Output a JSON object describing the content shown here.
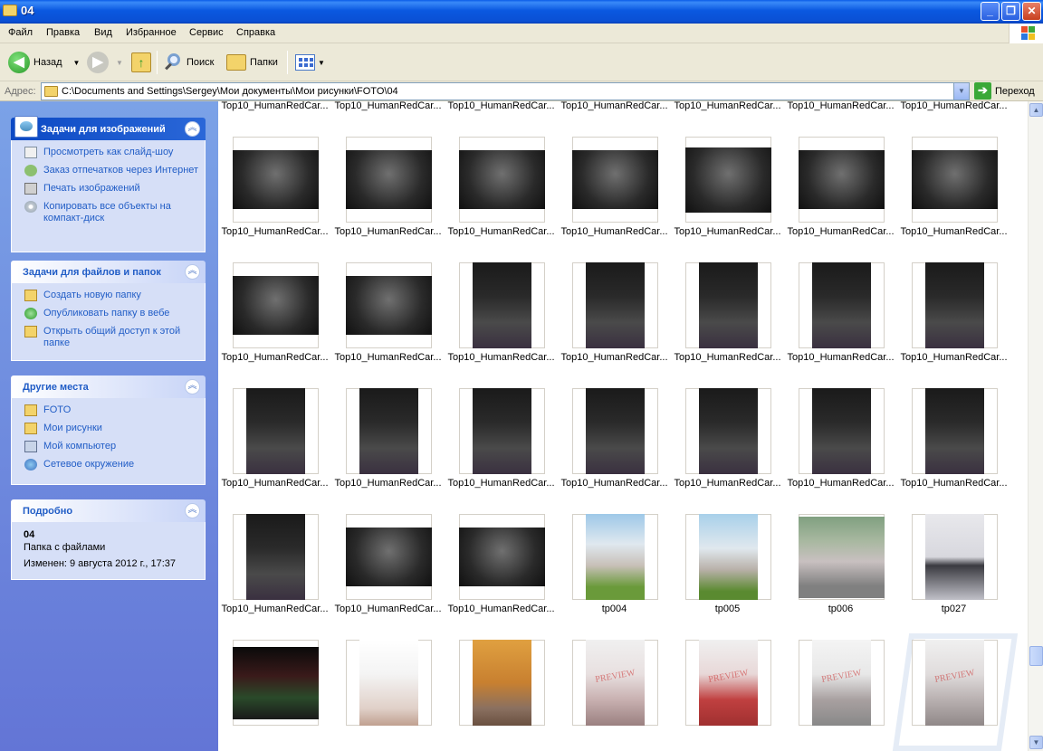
{
  "window": {
    "title": "04"
  },
  "menu": [
    "Файл",
    "Правка",
    "Вид",
    "Избранное",
    "Сервис",
    "Справка"
  ],
  "toolbar": {
    "back": "Назад",
    "search": "Поиск",
    "folders": "Папки"
  },
  "address": {
    "label": "Адрес:",
    "path": "C:\\Documents and Settings\\Sergey\\Мои документы\\Мои рисунки\\FOTO\\04",
    "go": "Переход"
  },
  "sidebar": {
    "image_tasks": {
      "title": "Задачи для изображений",
      "items": [
        "Просмотреть как слайд-шоу",
        "Заказ отпечатков через Интернет",
        "Печать изображений",
        "Копировать все объекты на компакт-диск"
      ]
    },
    "file_tasks": {
      "title": "Задачи для файлов и папок",
      "items": [
        "Создать новую папку",
        "Опубликовать папку в вебе",
        "Открыть общий доступ к этой папке"
      ]
    },
    "other_places": {
      "title": "Другие места",
      "items": [
        "FOTO",
        "Мои рисунки",
        "Мой компьютер",
        "Сетевое окружение"
      ]
    },
    "details": {
      "title": "Подробно",
      "name": "04",
      "type": "Папка с файлами",
      "modified": "Изменен: 9 августа 2012 г., 17:37"
    }
  },
  "files": {
    "row0": [
      "Top10_HumanRedCar...",
      "Top10_HumanRedCar...",
      "Top10_HumanRedCar...",
      "Top10_HumanRedCar...",
      "Top10_HumanRedCar...",
      "Top10_HumanRedCar...",
      "Top10_HumanRedCar..."
    ],
    "row1": [
      "Top10_HumanRedCar...",
      "Top10_HumanRedCar...",
      "Top10_HumanRedCar...",
      "Top10_HumanRedCar...",
      "Top10_HumanRedCar...",
      "Top10_HumanRedCar...",
      "Top10_HumanRedCar..."
    ],
    "row2": [
      "Top10_HumanRedCar...",
      "Top10_HumanRedCar...",
      "Top10_HumanRedCar...",
      "Top10_HumanRedCar...",
      "Top10_HumanRedCar...",
      "Top10_HumanRedCar...",
      "Top10_HumanRedCar..."
    ],
    "row3": [
      "Top10_HumanRedCar...",
      "Top10_HumanRedCar...",
      "Top10_HumanRedCar...",
      "Top10_HumanRedCar...",
      "Top10_HumanRedCar...",
      "Top10_HumanRedCar...",
      "Top10_HumanRedCar..."
    ],
    "row4": [
      "Top10_HumanRedCar...",
      "Top10_HumanRedCar...",
      "Top10_HumanRedCar...",
      "tp004",
      "tp005",
      "tp006",
      "tp027"
    ],
    "row5": [
      "",
      "",
      "",
      "",
      "",
      "",
      ""
    ]
  },
  "thumb_watermark": "PREVIEW"
}
